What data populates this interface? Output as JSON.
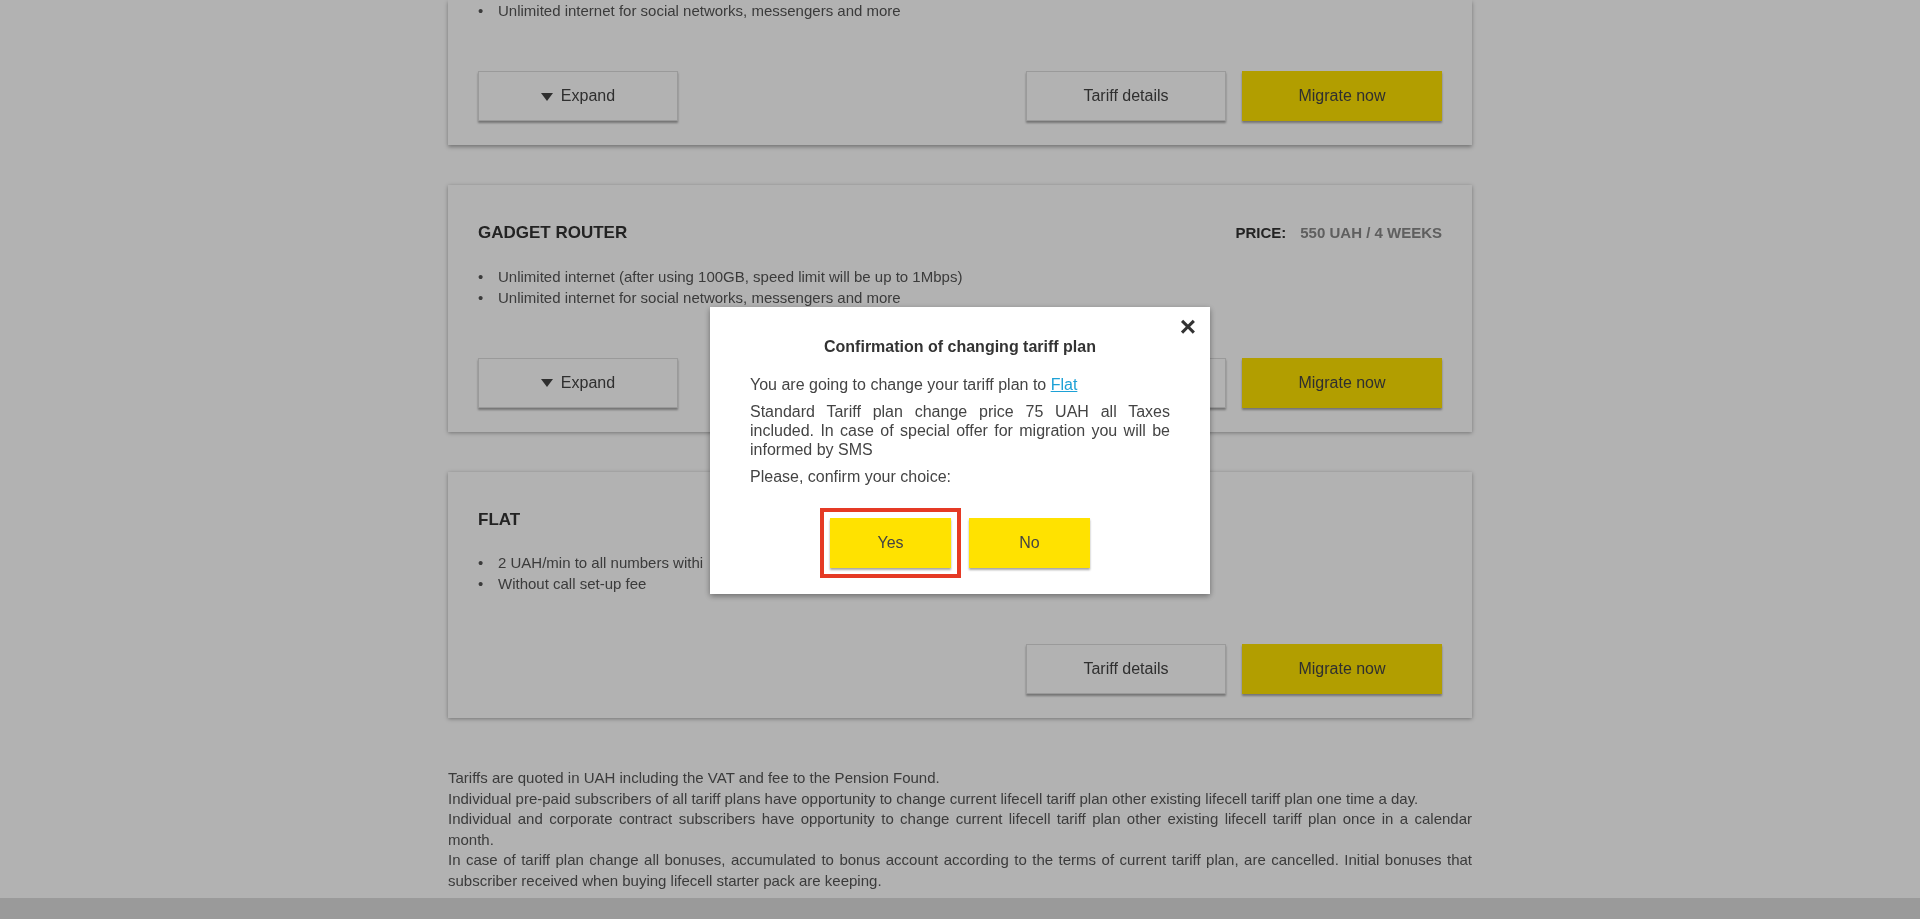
{
  "plans": [
    {
      "features": [
        {
          "bullet": "•",
          "text": "Unlimited internet for social networks, messengers and more"
        }
      ],
      "buttons": [
        {
          "kind": "expand",
          "label": "Expand"
        },
        {
          "kind": "details",
          "label": "Tariff details"
        },
        {
          "kind": "migrate",
          "label": "Migrate now"
        }
      ]
    },
    {
      "name": "GADGET ROUTER",
      "price_label": "PRICE:",
      "price": "550 UAH / 4 WEEKS",
      "features": [
        {
          "bullet": "•",
          "text": "Unlimited internet (after using 100GB, speed limit will be up to 1Mbps)"
        },
        {
          "bullet": "•",
          "text": "Unlimited internet for social networks, messengers and more"
        }
      ],
      "buttons": [
        {
          "kind": "expand",
          "label": "Expand"
        },
        {
          "kind": "details"
        },
        {
          "kind": "migrate",
          "label": "Migrate now"
        }
      ]
    },
    {
      "name": "FLAT",
      "features": [
        {
          "bullet": "•",
          "text": "2 UAH/min to all numbers withi"
        },
        {
          "bullet": "•",
          "text": "Without call set-up fee"
        }
      ],
      "buttons": [
        {
          "kind": "details",
          "label": "Tariff details"
        },
        {
          "kind": "migrate",
          "label": "Migrate now"
        }
      ]
    }
  ],
  "notes": [
    "Tariffs are quoted in UAH including the VAT and fee to the Pension Found.",
    "Individual pre-paid subscribers of all tariff plans have opportunity to change current lifecell tariff plan other existing lifecell tariff plan one time a day.",
    "Individual and corporate contract subscribers have opportunity to change current lifecell tariff plan other existing lifecell tariff plan once in a calendar month.",
    "In case of tariff plan change all bonuses, accumulated to bonus account according to the terms of current tariff plan, are cancelled. Initial bonuses that subscriber received when buying lifecell starter pack are keeping."
  ],
  "dialog": {
    "close": "×",
    "title": "Confirmation of changing tariff plan",
    "intro": "You are going to change your tariff plan to ",
    "plan_link": "Flat",
    "details": "Standard Tariff plan change price 75 UAH all Taxes included. In case of special offer for migration you will be informed by SMS",
    "prompt": "Please, confirm your choice:",
    "buttons": [
      {
        "label": "Yes",
        "highlighted": true
      },
      {
        "label": "No",
        "highlighted": false
      }
    ]
  }
}
